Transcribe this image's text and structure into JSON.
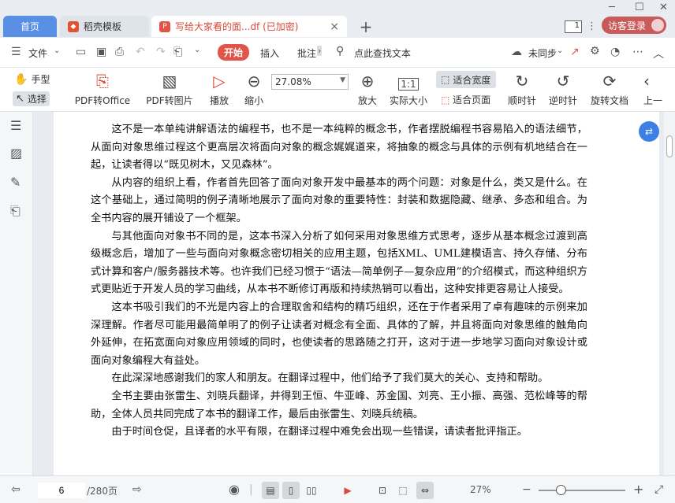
{
  "tabs": {
    "home": "首页",
    "template": "稻壳模板",
    "doc": "写给大家看的面...df (已加密)",
    "add": "+",
    "close": "×"
  },
  "window": {
    "page_count_badge": "1",
    "login": "访客登录"
  },
  "menu": {
    "file": "文件",
    "start": "开始",
    "insert": "插入",
    "annotate": "批注",
    "search": "点此查找文本",
    "sync": "未同步"
  },
  "toolbar": {
    "hand": "手型",
    "select": "选择",
    "pdf_to_office": "PDF转Office",
    "pdf_to_image": "PDF转图片",
    "play": "播放",
    "zoom_out": "缩小",
    "zoom_value": "27.08%",
    "zoom_in": "放大",
    "actual_size": "实际大小",
    "fit_width": "适合宽度",
    "fit_page": "适合页面",
    "rotate_cw": "顺时针",
    "rotate_ccw": "逆时针",
    "rotate_doc": "旋转文档",
    "prev": "上一"
  },
  "document": {
    "paragraphs": [
      "这不是一本单纯讲解语法的编程书，也不是一本纯粹的概念书，作者摆脱编程书容易陷入的语法细节，从面向对象思维过程这个更高层次将面向对象的概念娓娓道来，将抽象的概念与具体的示例有机地结合在一起，让读者得以“既见树木，又见森林”。",
      "从内容的组织上看，作者首先回答了面向对象开发中最基本的两个问题：对象是什么，类又是什么。在这个基础上，通过简明的例子清晰地展示了面向对象的重要特性：封装和数据隐藏、继承、多态和组合。为全书内容的展开铺设了一个框架。",
      "与其他面向对象书不同的是，这本书深入分析了如何采用对象思维方式思考，逐步从基本概念过渡到高级概念后，增加了一些与面向对象概念密切相关的应用主题，包括XML、UML建模语言、持久存储、分布式计算和客户/服务器技术等。也许我们已经习惯于“语法—简单例子—复杂应用”的介绍模式，而这种组织方式更贴近于开发人员的学习曲线，从本书不断修订再版和持续热销可以看出，这种安排更容易让人接受。",
      "这本书吸引我们的不光是内容上的合理取舍和结构的精巧组织，还在于作者采用了卓有趣味的示例来加深理解。作者尽可能用最简单明了的例子让读者对概念有全面、具体的了解，并且将面向对象思维的触角向外延伸，在拓宽面向对象应用领域的同时，也使读者的思路随之打开，这对于进一步地学习面向对象设计或面向对象编程大有益处。",
      "在此深深地感谢我们的家人和朋友。在翻译过程中，他们给予了我们莫大的关心、支持和帮助。",
      "全书主要由张雷生、刘晓兵翻译，并得到王恒、牛亚峰、苏金国、刘亮、王小振、高强、范松峰等的帮助，全体人员共同完成了本书的翻译工作，最后由张雷生、刘晓兵统稿。",
      "由于时间仓促，且译者的水平有限，在翻译过程中难免会出现一些错误，请读者批评指正。"
    ]
  },
  "status": {
    "current_page": "6",
    "total_pages": "/280页",
    "zoom": "27%"
  }
}
